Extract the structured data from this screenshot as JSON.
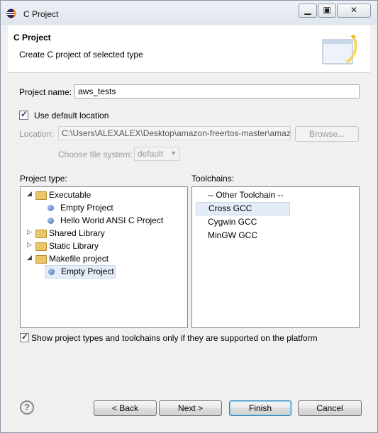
{
  "window": {
    "title": "C Project"
  },
  "header": {
    "title": "C Project",
    "subtitle": "Create C project of selected type"
  },
  "project_name": {
    "label": "Project name:",
    "value": "aws_tests"
  },
  "use_default_location": {
    "label": "Use default location",
    "checked": true
  },
  "location": {
    "label": "Location:",
    "value": "C:\\Users\\ALEXALEX\\Desktop\\amazon-freertos-master\\amaz",
    "browse_label": "Browse..."
  },
  "file_system": {
    "label": "Choose file system:",
    "value": "default"
  },
  "project_type": {
    "label": "Project type:",
    "items": [
      {
        "label": "Executable",
        "kind": "folder",
        "expanded": true
      },
      {
        "label": "Empty Project",
        "kind": "leaf"
      },
      {
        "label": "Hello World ANSI C Project",
        "kind": "leaf"
      },
      {
        "label": "Shared Library",
        "kind": "folder",
        "expanded": false
      },
      {
        "label": "Static Library",
        "kind": "folder",
        "expanded": false
      },
      {
        "label": "Makefile project",
        "kind": "folder",
        "expanded": true
      },
      {
        "label": "Empty Project",
        "kind": "leaf",
        "selected": true
      }
    ]
  },
  "toolchains": {
    "label": "Toolchains:",
    "items": [
      "-- Other Toolchain --",
      "Cross GCC",
      "Cygwin GCC",
      "MinGW GCC"
    ],
    "selected": "Cross GCC"
  },
  "show_supported": {
    "label": "Show project types and toolchains only if they are supported on the platform",
    "checked": true
  },
  "buttons": {
    "back": "< Back",
    "next": "Next >",
    "finish": "Finish",
    "cancel": "Cancel"
  },
  "icons": {
    "app": "eclipse-icon",
    "minimize": "minimize-icon",
    "maximize": "maximize-icon",
    "close": "close-icon",
    "help": "help-icon",
    "banner": "new-project-wizard-icon"
  }
}
